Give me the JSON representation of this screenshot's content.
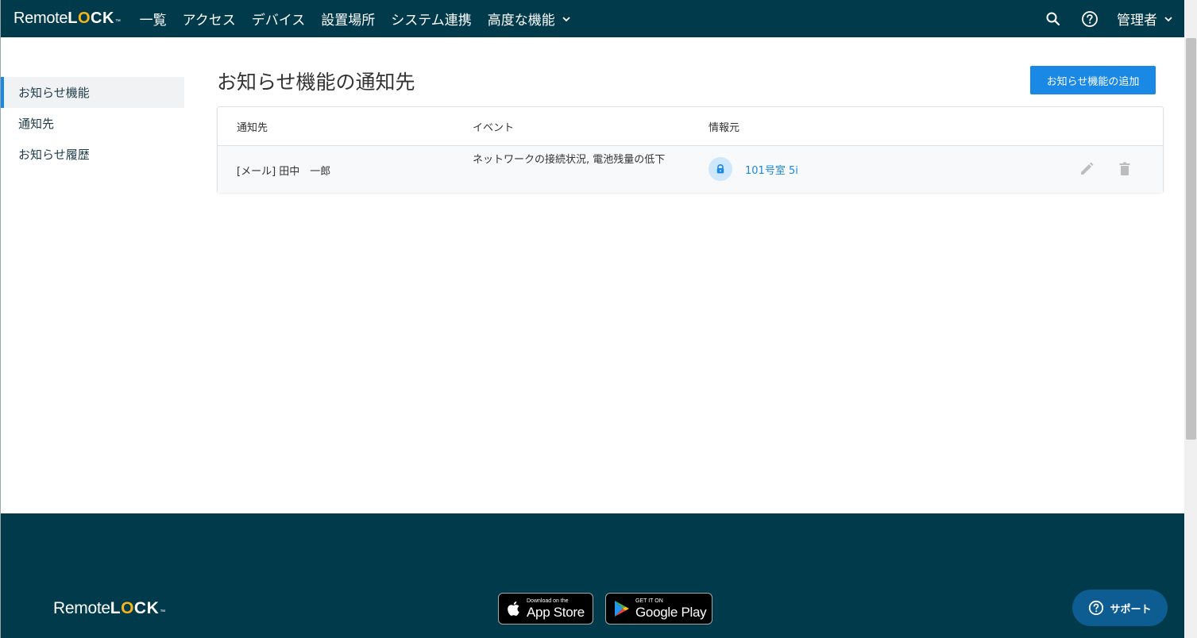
{
  "nav": {
    "logo_prefix": "Remote",
    "logo_l": "L",
    "logo_o": "O",
    "logo_suffix": "CK",
    "logo_tm": "™",
    "items": [
      "一覧",
      "アクセス",
      "デバイス",
      "設置場所",
      "システム連携",
      "高度な機能"
    ],
    "admin_label": "管理者"
  },
  "sidebar": {
    "items": [
      "お知らせ機能",
      "通知先",
      "お知らせ履歴"
    ]
  },
  "main": {
    "title": "お知らせ機能の通知先",
    "add_button": "お知らせ機能の追加",
    "table": {
      "headers": [
        "通知先",
        "イベント",
        "情報元"
      ],
      "rows": [
        {
          "recipient": "[メール] 田中　一郎",
          "event": "ネットワークの接続状況, 電池残量の低下",
          "source": "101号室 5i"
        }
      ]
    }
  },
  "footer": {
    "app_store_small": "Download on the",
    "app_store_big": "App Store",
    "google_small": "GET IT ON",
    "google_big": "Google Play",
    "support_label": "サポート"
  },
  "colors": {
    "nav_bg": "#003a4b",
    "accent": "#1a88e5",
    "logo_accent": "#f5b51b",
    "support_bg": "#0d5d93"
  }
}
